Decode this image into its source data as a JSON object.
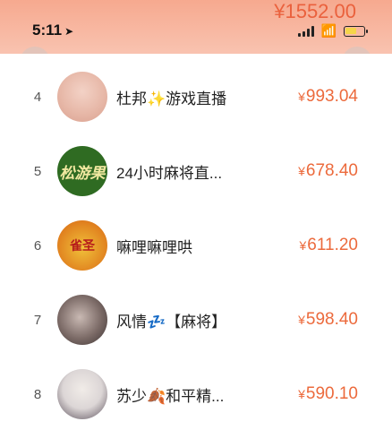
{
  "status": {
    "time": "5:11"
  },
  "header": {
    "peek_amount": "¥1552.00"
  },
  "colors": {
    "accent": "#ec6a3c",
    "band": "#f6a98f"
  },
  "icons": {
    "back": "chevron-left-icon",
    "share": "share-icon"
  },
  "rows": [
    {
      "rank": "4",
      "name": "杜邦✨游戏直播",
      "amount": "993.04",
      "avatar_text": ""
    },
    {
      "rank": "5",
      "name": "24小时麻将直...",
      "amount": "678.40",
      "avatar_text": "松游果"
    },
    {
      "rank": "6",
      "name": "嘛哩嘛哩哄",
      "amount": "611.20",
      "avatar_text": "雀圣"
    },
    {
      "rank": "7",
      "name": "风情💤【麻将】",
      "amount": "598.40",
      "avatar_text": ""
    },
    {
      "rank": "8",
      "name": "苏少🍂和平精...",
      "amount": "590.10",
      "avatar_text": ""
    }
  ],
  "currency": "¥"
}
